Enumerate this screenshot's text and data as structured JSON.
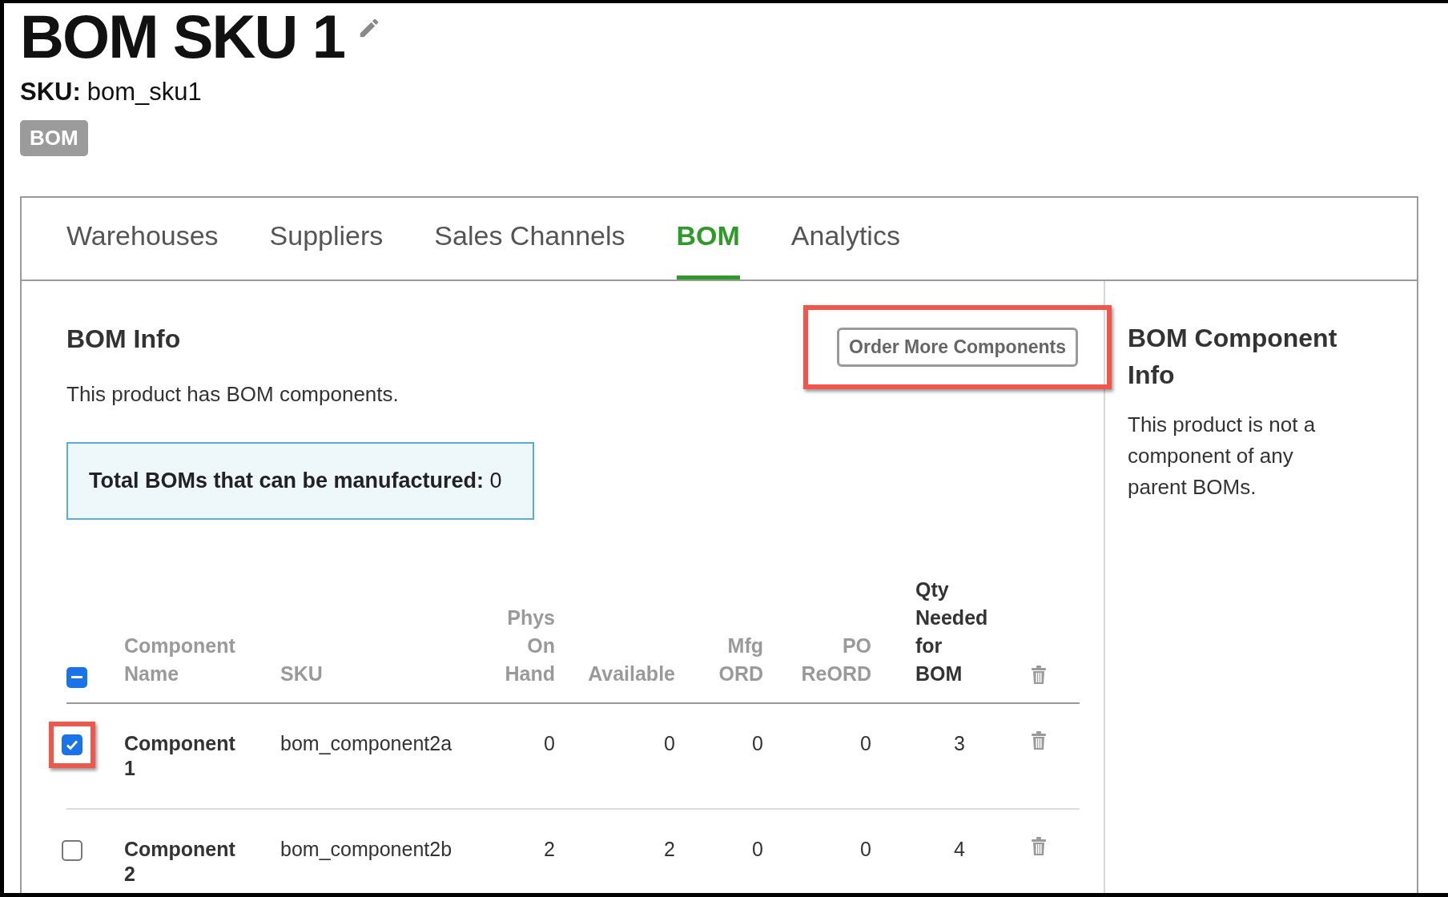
{
  "product": {
    "title": "BOM SKU 1",
    "sku_label": "SKU:",
    "sku": "bom_sku1",
    "badge": "BOM"
  },
  "tabs": [
    {
      "label": "Warehouses",
      "selected": false
    },
    {
      "label": "Suppliers",
      "selected": false
    },
    {
      "label": "Sales Channels",
      "selected": false
    },
    {
      "label": "BOM",
      "selected": true
    },
    {
      "label": "Analytics",
      "selected": false
    }
  ],
  "bom_info": {
    "heading": "BOM Info",
    "text": "This product has BOM components.",
    "total_label": "Total BOMs that can be manufactured:",
    "total_value": "0",
    "order_button": {
      "label": "Order More Components",
      "annotated": true
    }
  },
  "table": {
    "header_checkbox": {
      "indeterminate": true
    },
    "columns": [
      {
        "label": "Component Name",
        "active": false
      },
      {
        "label": "SKU",
        "active": false
      },
      {
        "label": "Phys On Hand",
        "active": false
      },
      {
        "label": "Available",
        "active": false
      },
      {
        "label": "Mfg ORD",
        "active": false
      },
      {
        "label": "PO ReORD",
        "active": false
      },
      {
        "label": "Qty Needed for BOM",
        "active": true
      }
    ],
    "rows": [
      {
        "selected": true,
        "annotated": true,
        "cells": [
          "Component 1",
          "bom_component2a",
          "0",
          "0",
          "0",
          "0",
          "3"
        ]
      },
      {
        "selected": false,
        "annotated": false,
        "cells": [
          "Component 2",
          "bom_component2b",
          "2",
          "2",
          "0",
          "0",
          "4"
        ]
      }
    ]
  },
  "component_info": {
    "heading": "BOM Component Info",
    "text": "This product is not a component of any parent BOMs."
  }
}
